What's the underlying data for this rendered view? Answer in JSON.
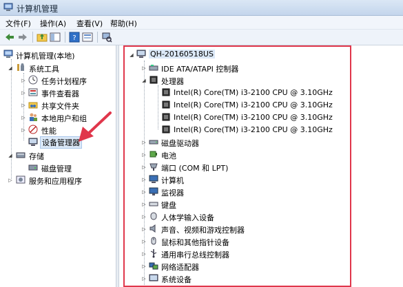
{
  "window": {
    "title": "计算机管理"
  },
  "menu": [
    "文件(F)",
    "操作(A)",
    "查看(V)",
    "帮助(H)"
  ],
  "left_tree": {
    "root": "计算机管理(本地)",
    "system_tools": "系统工具",
    "children": [
      "任务计划程序",
      "事件查看器",
      "共享文件夹",
      "本地用户和组",
      "性能",
      "设备管理器"
    ],
    "storage": "存储",
    "disk_mgmt": "磁盘管理",
    "services": "服务和应用程序"
  },
  "right_tree": {
    "computer": "QH-20160518US",
    "ide": "IDE ATA/ATAPI 控制器",
    "processor": "处理器",
    "cpus": [
      "Intel(R) Core(TM) i3-2100 CPU @ 3.10GHz",
      "Intel(R) Core(TM) i3-2100 CPU @ 3.10GHz",
      "Intel(R) Core(TM) i3-2100 CPU @ 3.10GHz",
      "Intel(R) Core(TM) i3-2100 CPU @ 3.10GHz"
    ],
    "categories": [
      "磁盘驱动器",
      "电池",
      "端口 (COM 和 LPT)",
      "计算机",
      "监视器",
      "键盘",
      "人体学输入设备",
      "声音、视频和游戏控制器",
      "鼠标和其他指针设备",
      "通用串行总线控制器",
      "网络适配器",
      "系统设备"
    ]
  },
  "colors": {
    "highlight_box": "#e0364b",
    "arrow": "#e0364b"
  }
}
